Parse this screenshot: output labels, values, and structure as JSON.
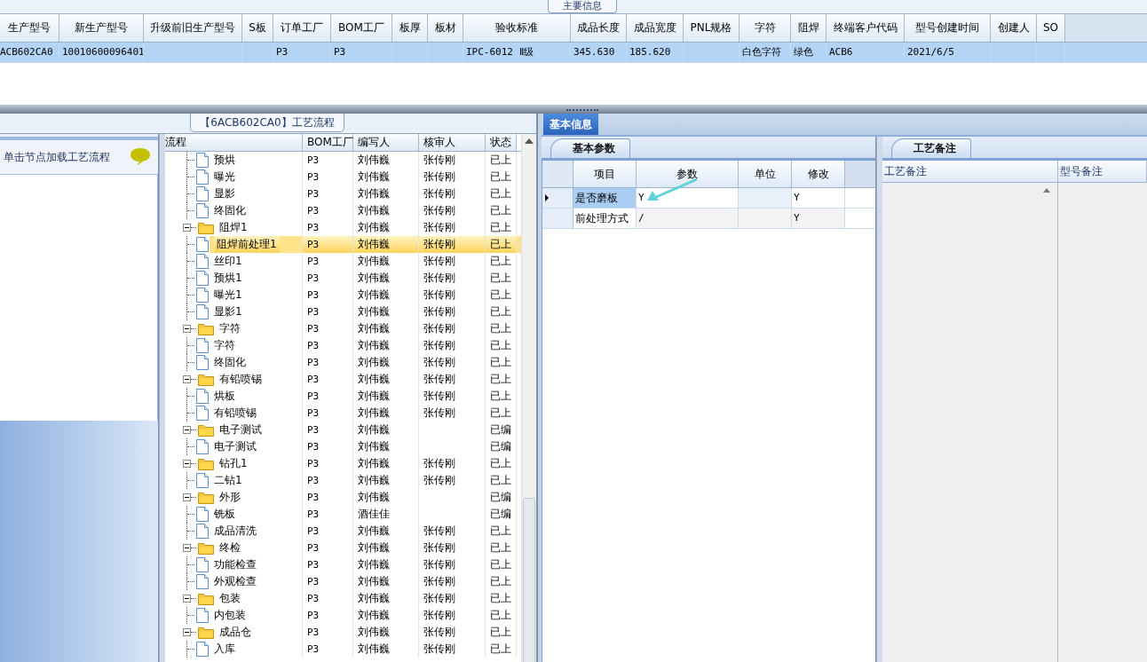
{
  "main_info": {
    "title": "主要信息",
    "columns": [
      "生产型号",
      "新生产型号",
      "升级前旧生产型号",
      "S板",
      "订单工厂",
      "BOM工厂",
      "板厚",
      "板材",
      "验收标准",
      "成品长度",
      "成品宽度",
      "PNL规格",
      "字符",
      "阻焊",
      "终端客户代码",
      "型号创建时间",
      "创建人",
      "SO"
    ],
    "rows": [
      {
        "selected": true,
        "cells": [
          "ACB602CA0",
          "10010600096401",
          "",
          "",
          "P3",
          "P3",
          "",
          "",
          "IPC-6012 Ⅱ级",
          "345.630",
          "185.620",
          "",
          "白色字符",
          "绿色",
          "ACB6",
          "2021/6/5",
          "",
          ""
        ]
      }
    ]
  },
  "left_panel": {
    "hint": "单击节点加载工艺流程"
  },
  "process": {
    "title": "【6ACB602CA0】工艺流程",
    "columns": [
      "流程",
      "BOM工厂",
      "编写人",
      "核审人",
      "状态"
    ],
    "tree": [
      {
        "children": [
          {
            "label": "预烘",
            "bom": "P3",
            "author": "刘伟巍",
            "reviewer": "张传刚",
            "status": "已上",
            "selected": false
          },
          {
            "label": "曝光",
            "bom": "P3",
            "author": "刘伟巍",
            "reviewer": "张传刚",
            "status": "已上",
            "selected": false
          },
          {
            "label": "显影",
            "bom": "P3",
            "author": "刘伟巍",
            "reviewer": "张传刚",
            "status": "已上",
            "selected": false
          },
          {
            "label": "终固化",
            "bom": "P3",
            "author": "刘伟巍",
            "reviewer": "张传刚",
            "status": "已上",
            "selected": false
          }
        ]
      },
      {
        "label": "阻焊1",
        "bom": "P3",
        "author": "刘伟巍",
        "reviewer": "张传刚",
        "status": "已上",
        "selected": false,
        "expanded": true,
        "children": [
          {
            "label": "阻焊前处理1",
            "bom": "P3",
            "author": "刘伟巍",
            "reviewer": "张传刚",
            "status": "已上",
            "selected": true
          },
          {
            "label": "丝印1",
            "bom": "P3",
            "author": "刘伟巍",
            "reviewer": "张传刚",
            "status": "已上",
            "selected": false
          },
          {
            "label": "预烘1",
            "bom": "P3",
            "author": "刘伟巍",
            "reviewer": "张传刚",
            "status": "已上",
            "selected": false
          },
          {
            "label": "曝光1",
            "bom": "P3",
            "author": "刘伟巍",
            "reviewer": "张传刚",
            "status": "已上",
            "selected": false
          },
          {
            "label": "显影1",
            "bom": "P3",
            "author": "刘伟巍",
            "reviewer": "张传刚",
            "status": "已上",
            "selected": false
          }
        ]
      },
      {
        "label": "字符",
        "bom": "P3",
        "author": "刘伟巍",
        "reviewer": "张传刚",
        "status": "已上",
        "selected": false,
        "expanded": true,
        "children": [
          {
            "label": "字符",
            "bom": "P3",
            "author": "刘伟巍",
            "reviewer": "张传刚",
            "status": "已上",
            "selected": false
          },
          {
            "label": "终固化",
            "bom": "P3",
            "author": "刘伟巍",
            "reviewer": "张传刚",
            "status": "已上",
            "selected": false
          }
        ]
      },
      {
        "label": "有铅喷锡",
        "bom": "P3",
        "author": "刘伟巍",
        "reviewer": "张传刚",
        "status": "已上",
        "selected": false,
        "expanded": true,
        "children": [
          {
            "label": "烘板",
            "bom": "P3",
            "author": "刘伟巍",
            "reviewer": "张传刚",
            "status": "已上",
            "selected": false
          },
          {
            "label": "有铅喷锡",
            "bom": "P3",
            "author": "刘伟巍",
            "reviewer": "张传刚",
            "status": "已上",
            "selected": false
          }
        ]
      },
      {
        "label": "电子测试",
        "bom": "P3",
        "author": "刘伟巍",
        "status": "已编",
        "selected": false,
        "expanded": true,
        "children": [
          {
            "label": "电子测试",
            "bom": "P3",
            "author": "刘伟巍",
            "status": "已编",
            "selected": false
          }
        ]
      },
      {
        "label": "钻孔1",
        "bom": "P3",
        "author": "刘伟巍",
        "reviewer": "张传刚",
        "status": "已上",
        "selected": false,
        "expanded": true,
        "children": [
          {
            "label": "二钻1",
            "bom": "P3",
            "author": "刘伟巍",
            "reviewer": "张传刚",
            "status": "已上",
            "selected": false
          }
        ]
      },
      {
        "label": "外形",
        "bom": "P3",
        "author": "刘伟巍",
        "status": "已编",
        "selected": false,
        "expanded": true,
        "children": [
          {
            "label": "铣板",
            "bom": "P3",
            "author": "酒佳佳",
            "status": "已编",
            "selected": false
          },
          {
            "label": "成品清洗",
            "bom": "P3",
            "author": "刘伟巍",
            "reviewer": "张传刚",
            "status": "已上",
            "selected": false
          }
        ]
      },
      {
        "label": "终检",
        "bom": "P3",
        "author": "刘伟巍",
        "reviewer": "张传刚",
        "status": "已上",
        "selected": false,
        "expanded": true,
        "children": [
          {
            "label": "功能检查",
            "bom": "P3",
            "author": "刘伟巍",
            "reviewer": "张传刚",
            "status": "已上",
            "selected": false
          },
          {
            "label": "外观检查",
            "bom": "P3",
            "author": "刘伟巍",
            "reviewer": "张传刚",
            "status": "已上",
            "selected": false
          }
        ]
      },
      {
        "label": "包装",
        "bom": "P3",
        "author": "刘伟巍",
        "reviewer": "张传刚",
        "status": "已上",
        "selected": false,
        "expanded": true,
        "children": [
          {
            "label": "内包装",
            "bom": "P3",
            "author": "刘伟巍",
            "reviewer": "张传刚",
            "status": "已上",
            "selected": false
          }
        ]
      },
      {
        "label": "成品仓",
        "bom": "P3",
        "author": "刘伟巍",
        "reviewer": "张传刚",
        "status": "已上",
        "selected": false,
        "expanded": true,
        "children": [
          {
            "label": "入库",
            "bom": "P3",
            "author": "刘伟巍",
            "reviewer": "张传刚",
            "status": "已上",
            "selected": false
          }
        ]
      }
    ]
  },
  "basic_info": {
    "tab": "基本信息",
    "selected": true,
    "params": {
      "tab": "基本参数",
      "columns": [
        "项目",
        "参数",
        "单位",
        "修改"
      ],
      "rows": [
        {
          "current": true,
          "selected": true,
          "cells": [
            "是否磨板",
            "Y",
            "",
            "Y"
          ]
        },
        {
          "current": false,
          "selected": false,
          "cells": [
            "前处理方式",
            "/",
            "",
            "Y"
          ]
        }
      ]
    },
    "notes": {
      "tab": "工艺备注",
      "columns": [
        "工艺备注",
        "型号备注"
      ]
    }
  }
}
